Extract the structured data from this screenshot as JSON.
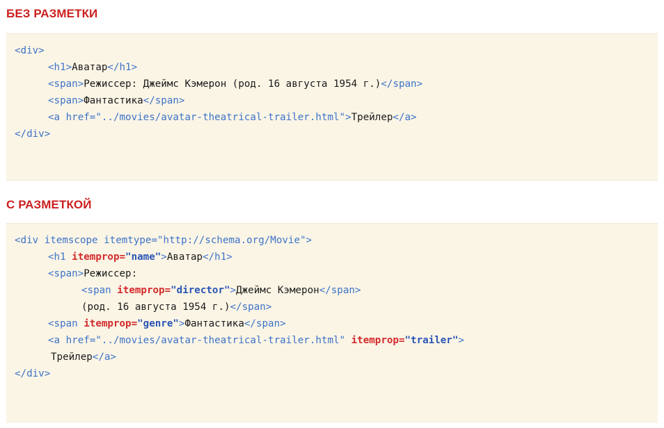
{
  "section1": {
    "title": "БЕЗ РАЗМЕТКИ",
    "code": {
      "l1_open": "<div>",
      "l2_h1_open": "<h1>",
      "l2_text": "Аватар",
      "l2_h1_close": "</h1>",
      "l3_span_open": "<span>",
      "l3_text": "Режиссер: Джеймс Кэмерон (род. 16 августа 1954 г.)",
      "l3_span_close": "</span>",
      "l4_span_open": "<span>",
      "l4_text": "Фантастика",
      "l4_span_close": "</span>",
      "l5_a_open": "<a href=\"../movies/avatar-theatrical-trailer.html\">",
      "l5_text": "Трейлер",
      "l5_a_close": "</a>",
      "l6_close": "</div>"
    }
  },
  "section2": {
    "title": "С РАЗМЕТКОЙ",
    "code": {
      "l1_open": "<div itemscope itemtype=\"http://schema.org/Movie\">",
      "l2_h1_open": "<h1 ",
      "l2_attr": "itemprop=",
      "l2_val": "\"name\"",
      "l2_gt": ">",
      "l2_text": "Аватар",
      "l2_h1_close": "</h1>",
      "l3_span_open": "<span>",
      "l3_text": "Режиссер:",
      "l4_span_open": "<span ",
      "l4_attr": "itemprop=",
      "l4_val": "\"director\"",
      "l4_gt": ">",
      "l4_text": "Джеймс Кэмерон",
      "l4_span_close": "</span>",
      "l5_text": "(род. 16 августа 1954 г.)",
      "l5_span_close": "</span>",
      "l6_span_open": "<span ",
      "l6_attr": "itemprop=",
      "l6_val": "\"genre\"",
      "l6_gt": ">",
      "l6_text": "Фантастика",
      "l6_span_close": "</span>",
      "l7_a_open": "<a href=\"../movies/avatar-theatrical-trailer.html\" ",
      "l7_attr": "itemprop=",
      "l7_val": "\"trailer\"",
      "l7_gt": ">",
      "l8_text": "Трейлер",
      "l8_a_close": "</a>",
      "l9_close": "</div>"
    }
  }
}
